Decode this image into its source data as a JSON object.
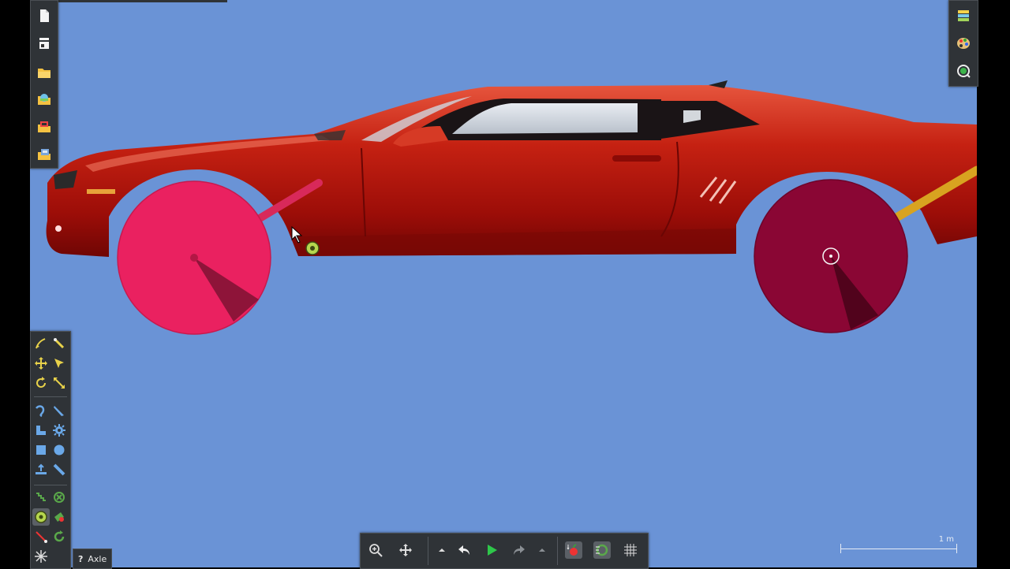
{
  "app": {
    "status_tool_name": "Axle",
    "help_glyph": "?"
  },
  "scale": {
    "label": "1 m"
  },
  "colors": {
    "background": "#6a93d6",
    "car_body": "#c21d10",
    "front_wheel": "#ea2160",
    "rear_wheel": "#8a0634",
    "front_strut": "#d8295a",
    "rear_strut": "#d8a320",
    "panel": "#2f3337"
  },
  "file_toolbar": {
    "items": [
      "new-scene-icon",
      "properties-icon",
      "open-folder-icon",
      "open-scene-icon",
      "open-photo-icon",
      "save-scene-icon"
    ]
  },
  "right_toolbar": {
    "items": [
      "layers-icon",
      "palette-icon",
      "zoom-to-selection-icon"
    ]
  },
  "tools_toolbar": {
    "items": [
      "sketch-icon",
      "brush-icon",
      "move-icon",
      "drag-icon",
      "rotate-icon",
      "scale-icon",
      "rope-icon",
      "knife-icon",
      "polygon-icon",
      "gear-icon",
      "box-icon",
      "circle-icon",
      "plane-icon",
      "ray-icon",
      "chain-icon",
      "fixate-icon",
      "axle-icon",
      "thruster-icon",
      "tracer-icon",
      "laser-icon",
      "spring-icon"
    ],
    "active": "axle-icon"
  },
  "sim_toolbar": {
    "items": [
      "zoom-icon",
      "pan-icon",
      "step-up-icon",
      "undo-icon",
      "play-icon",
      "redo-icon",
      "step-down-icon",
      "gravity-icon",
      "air-friction-icon",
      "grid-icon"
    ]
  }
}
